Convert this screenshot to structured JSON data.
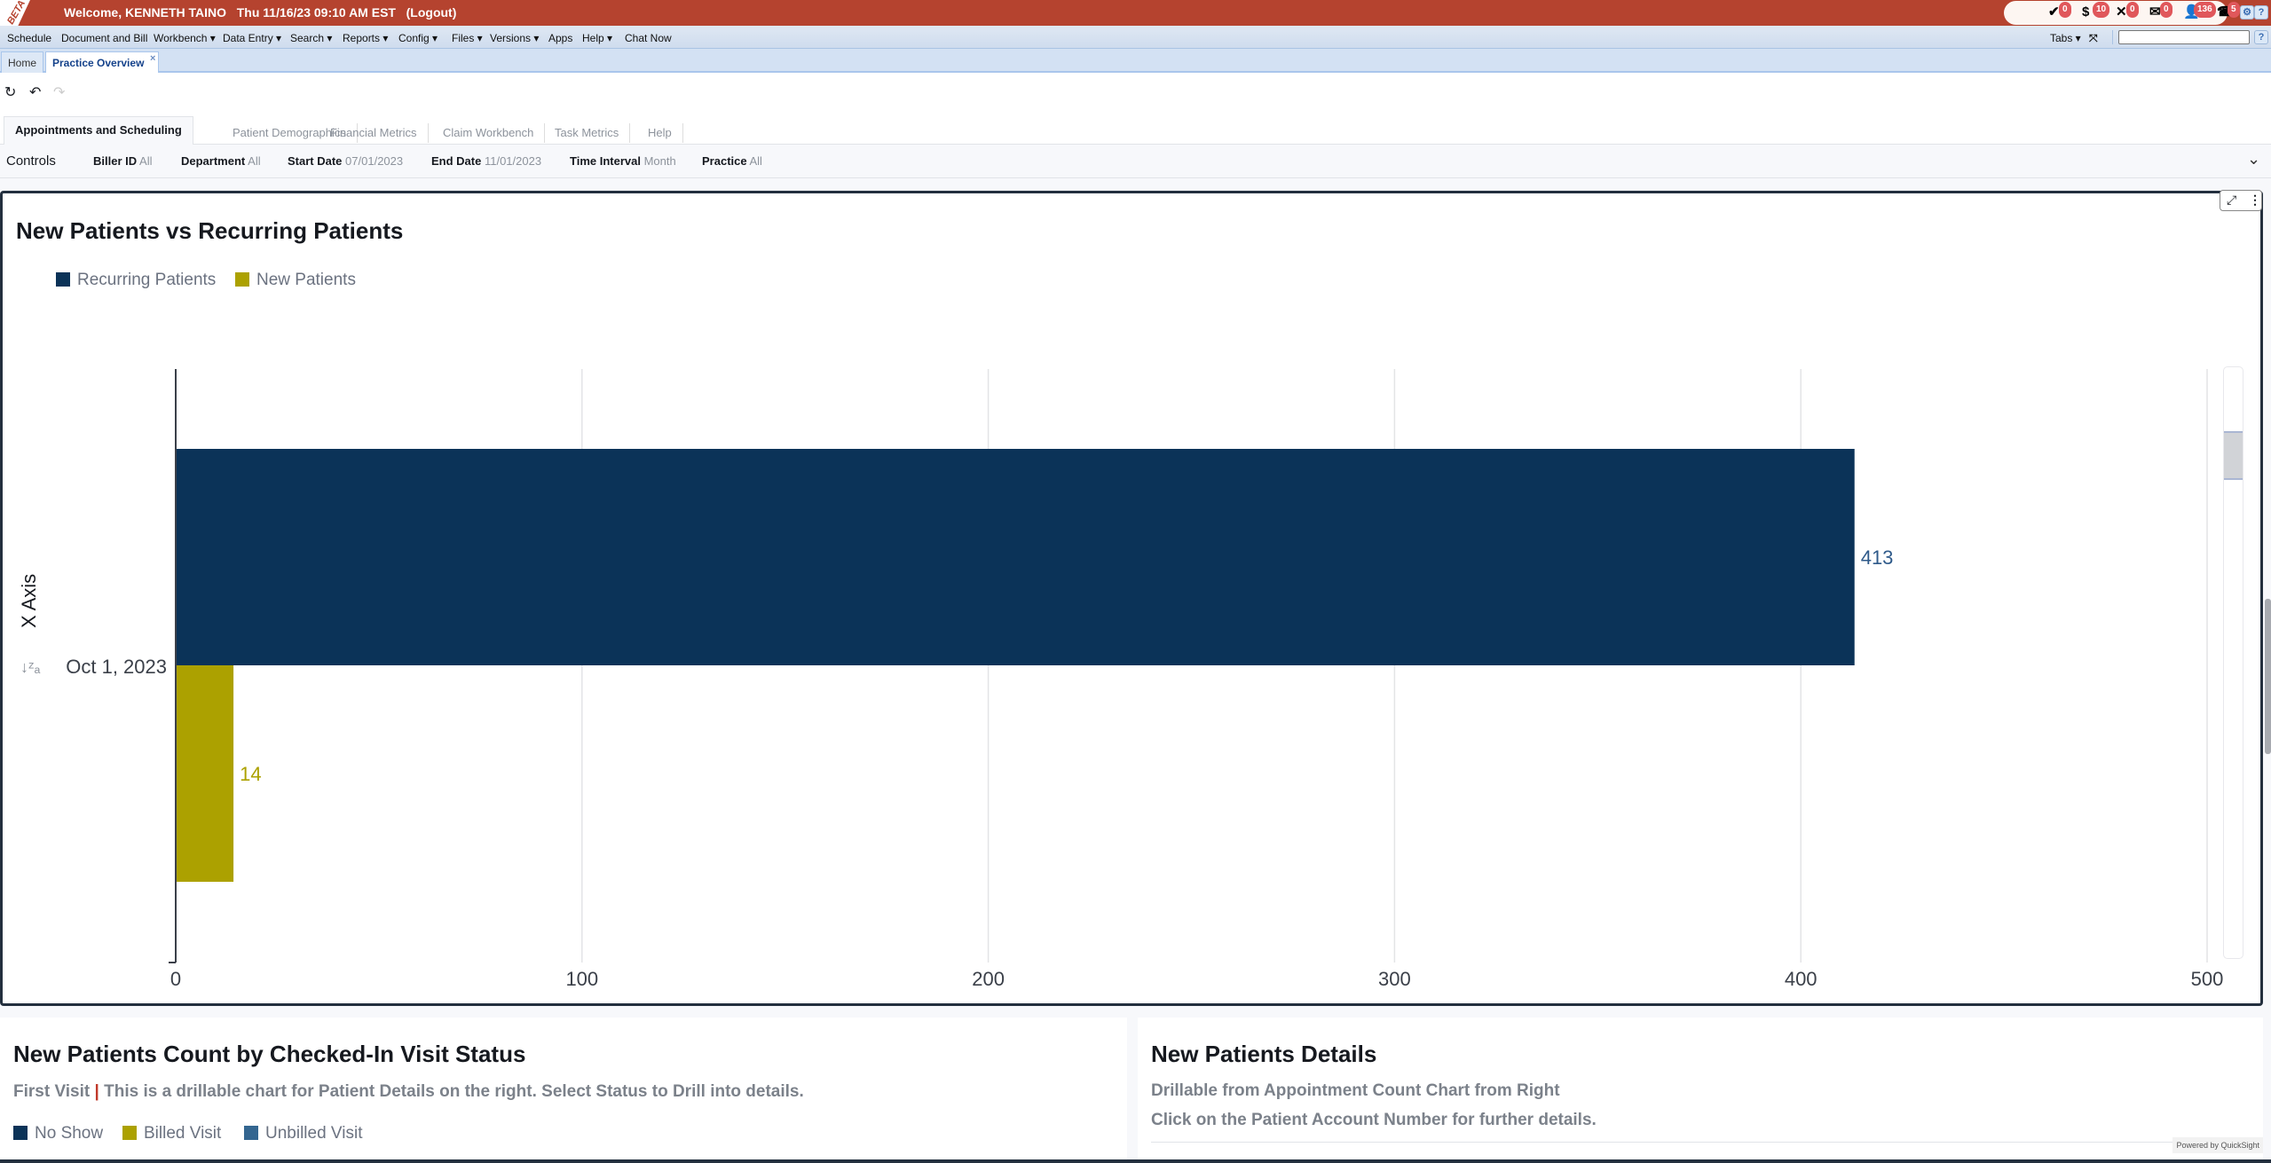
{
  "topbar": {
    "beta": "BETA",
    "welcome": "Welcome, KENNETH TAINO",
    "datetime": "Thu 11/16/23 09:10 AM EST",
    "logout": "(Logout)",
    "notifications": [
      {
        "icon": "check-circle-icon",
        "glyph": "✔",
        "count": "0"
      },
      {
        "icon": "no-dollar-icon",
        "glyph": "$",
        "count": "10"
      },
      {
        "icon": "tools-icon",
        "glyph": "✕",
        "count": "0"
      },
      {
        "icon": "mail-icon",
        "glyph": "✉",
        "count": "0"
      },
      {
        "icon": "contact-icon",
        "glyph": "👤",
        "count": "136"
      },
      {
        "icon": "fax-icon",
        "glyph": "☎",
        "count": "5"
      }
    ],
    "settings": "⚙",
    "help": "?"
  },
  "menu": {
    "items": [
      "Schedule",
      "Document and Bill",
      "Workbench ▾",
      "Data Entry ▾",
      "Search ▾",
      "Reports ▾",
      "Config ▾",
      "Files ▾",
      "Versions ▾",
      "Apps",
      "Help ▾",
      "Chat Now"
    ],
    "tabs_label": "Tabs ▾",
    "search_value": "",
    "help": "?"
  },
  "tabs": [
    {
      "label": "Home"
    },
    {
      "label": "Practice Overview",
      "close": "×"
    }
  ],
  "sheet_tabs": [
    "Appointments and Scheduling",
    "Patient Demographics",
    "Financial Metrics",
    "Claim Workbench",
    "Task Metrics",
    "Help"
  ],
  "controls": {
    "label": "Controls",
    "filters": [
      {
        "name": "Biller ID",
        "value": "All"
      },
      {
        "name": "Department",
        "value": "All"
      },
      {
        "name": "Start Date",
        "value": "07/01/2023"
      },
      {
        "name": "End Date",
        "value": "11/01/2023"
      },
      {
        "name": "Time Interval",
        "value": "Month"
      },
      {
        "name": "Practice",
        "value": "All"
      }
    ]
  },
  "chart_data": {
    "type": "bar",
    "orientation": "horizontal",
    "title": "New Patients vs Recurring Patients",
    "categories": [
      "Oct 1, 2023"
    ],
    "series": [
      {
        "name": "Recurring Patients",
        "values": [
          413
        ],
        "color": "#0b3358"
      },
      {
        "name": "New Patients",
        "values": [
          14
        ],
        "color": "#aca100"
      }
    ],
    "ylabel": "X Axis",
    "xlim": [
      0,
      500
    ],
    "ticks": [
      0,
      100,
      200,
      300,
      400,
      500
    ],
    "grid": true,
    "legend": "top-left"
  },
  "panels": {
    "left": {
      "title": "New Patients Count by Checked-In Visit Status",
      "subtitle_a": "First Visit",
      "subtitle_sep": " | ",
      "subtitle_b": "This is a drillable chart for Patient Details on the right. Select Status to Drill into details.",
      "legend": [
        {
          "label": "No Show",
          "color": "#0b3358"
        },
        {
          "label": "Billed Visit",
          "color": "#aca100"
        },
        {
          "label": "Unbilled Visit",
          "color": "#346690"
        }
      ]
    },
    "right": {
      "title": "New Patients Details",
      "line1": "Drillable from Appointment Count Chart from Right",
      "line2": "Click on the Patient Account Number for further details."
    }
  },
  "footer": {
    "powered_by": "Powered by QuickSight"
  }
}
